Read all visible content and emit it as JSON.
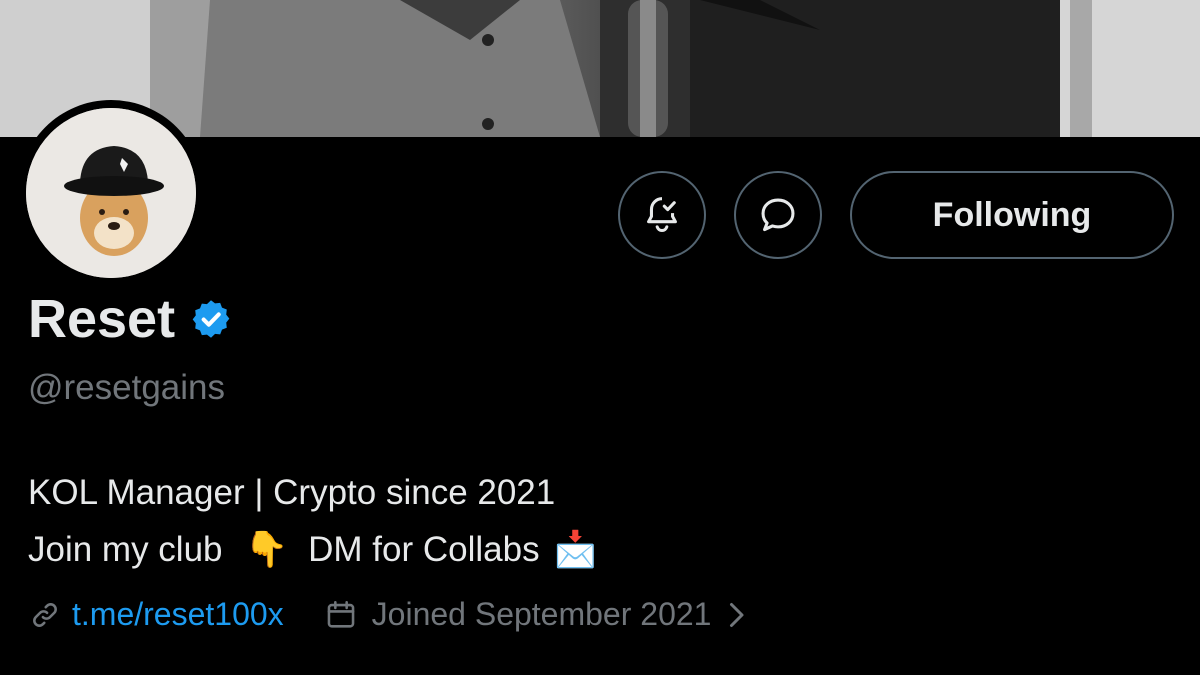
{
  "profile": {
    "name": "Reset",
    "handle": "@resetgains",
    "verified": true,
    "verified_color": "#1d9bf0",
    "bio_line1": "KOL Manager | Crypto since 2021",
    "bio_line2_part1": "Join my club",
    "bio_line2_emoji1": "👇",
    "bio_line2_part2": "DM for Collabs",
    "bio_line2_emoji2": "📩",
    "link": "t.me/reset100x",
    "joined": "Joined September 2021"
  },
  "actions": {
    "notify_icon": "bell-check-icon",
    "message_icon": "message-bubble-icon",
    "follow_label": "Following"
  },
  "colors": {
    "background": "#000000",
    "text": "#e7e9ea",
    "secondary": "#71767b",
    "link": "#1d9bf0",
    "border": "#536471"
  }
}
